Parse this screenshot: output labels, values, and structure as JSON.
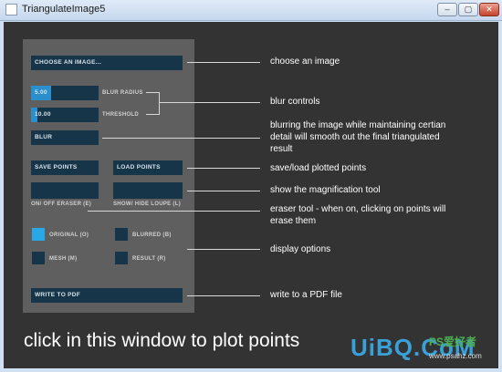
{
  "window": {
    "title": "TriangulateImage5",
    "min_label": "–",
    "max_label": "▢",
    "close_label": "✕"
  },
  "panel": {
    "choose_button": "CHOOSE AN IMAGE...",
    "blur_radius": {
      "value": "5.00",
      "label": "BLUR RADIUS",
      "fill_fraction": 0.3
    },
    "threshold": {
      "value": "10.00",
      "label": "THRESHOLD",
      "fill_fraction": 0.1
    },
    "blur_button": "BLUR",
    "save_button": "SAVE POINTS",
    "load_button": "LOAD POINTS",
    "eraser_toggle": {
      "label": "ON/ OFF ERASER (E)",
      "on": false
    },
    "loupe_toggle": {
      "label": "SHOW/ HIDE LOUPE (L)",
      "on": false
    },
    "display_options": [
      {
        "label": "ORIGINAL (O)",
        "on": true
      },
      {
        "label": "BLURRED (B)",
        "on": false
      },
      {
        "label": "MESH (M)",
        "on": false
      },
      {
        "label": "RESULT (R)",
        "on": false
      }
    ],
    "pdf_button": "WRITE TO PDF"
  },
  "annotations": {
    "choose": "choose an image",
    "blur_controls": "blur controls",
    "blur_desc_1": "blurring the image while maintaining certian",
    "blur_desc_2": "detail will smooth out the final triangulated",
    "blur_desc_3": "result",
    "save_load": "save/load plotted points",
    "magnify": "show the magnification tool",
    "eraser_1": "eraser tool - when on, clicking on points will",
    "eraser_2": "erase them",
    "display": "display options",
    "pdf": "write to a PDF file"
  },
  "canvas_hint": "click in this window to plot points",
  "watermark": {
    "logo": "UiBQ.CoM",
    "cn": "PS爱好者",
    "url": "www.psahz.com"
  },
  "colors": {
    "canvas": "#333333",
    "panel": "#5f5f5f",
    "field": "#173549",
    "accent": "#2a8fcc"
  }
}
